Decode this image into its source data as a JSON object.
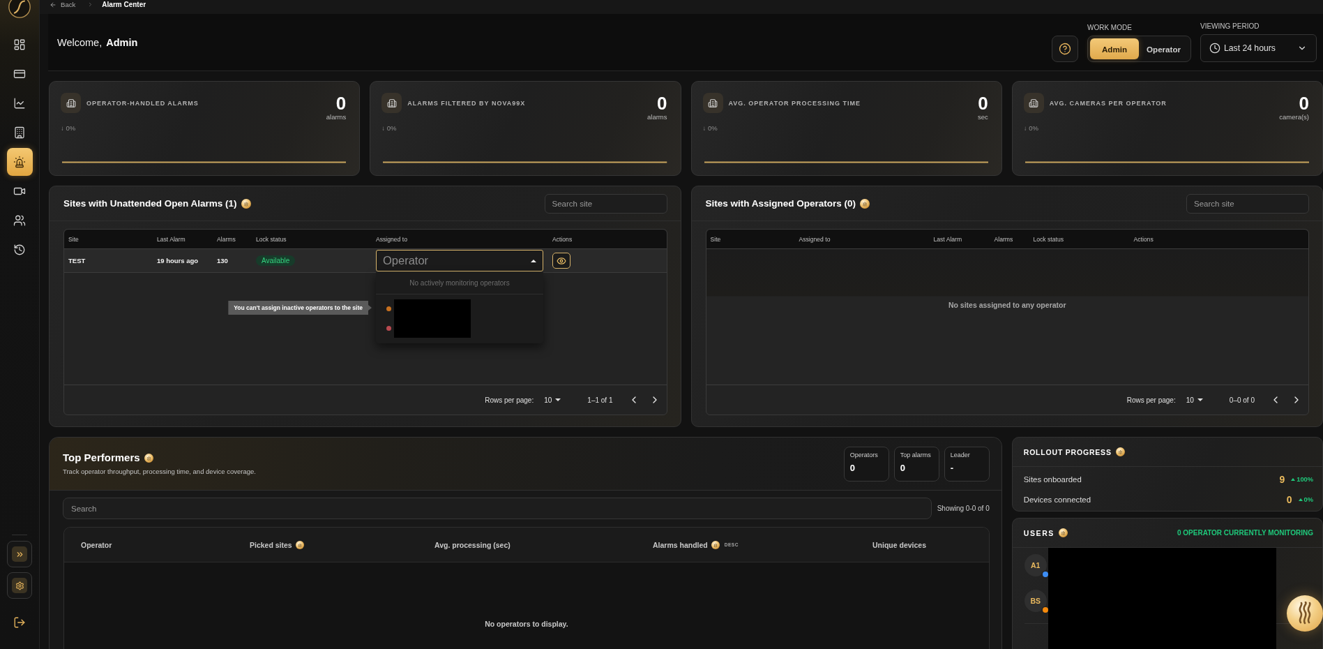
{
  "breadcrumb": {
    "back": "Back",
    "current": "Alarm Center"
  },
  "sidebar": {
    "items": [
      {
        "selected": false
      },
      {
        "selected": false
      },
      {
        "selected": false
      },
      {
        "selected": false
      },
      {
        "selected": true
      },
      {
        "selected": false
      },
      {
        "selected": false
      },
      {
        "selected": false
      }
    ]
  },
  "header": {
    "welcome": "Welcome, **Admin**",
    "work_mode": {
      "label": "WORK MODE",
      "options": [
        {
          "label": "Admin",
          "selected": true
        },
        {
          "label": "Operator",
          "selected": false
        }
      ]
    },
    "viewing_period": {
      "label": "VIEWING PERIOD",
      "value": "Last 24 hours"
    }
  },
  "stat_cards": [
    {
      "title": "OPERATOR-HANDLED ALARMS",
      "value": "0",
      "unit": "alarms",
      "change": "↓ 0%"
    },
    {
      "title": "ALARMS FILTERED BY NOVA99X",
      "value": "0",
      "unit": "alarms",
      "change": "↓ 0%"
    },
    {
      "title": "AVG. OPERATOR PROCESSING TIME",
      "value": "0",
      "unit": "sec",
      "change": "↓ 0%"
    },
    {
      "title": "AVG. CAMERAS PER OPERATOR",
      "value": "0",
      "unit": "camera(s)",
      "change": "↓ 0%"
    }
  ],
  "unattended_sites": {
    "title": "Sites with Unattended Open Alarms (1)",
    "search": {
      "placeholder": "Search site"
    },
    "columns": [
      "Site",
      "Last Alarm",
      "Alarms",
      "Lock status",
      "Assigned to",
      "Actions"
    ],
    "rows": [
      {
        "site": "TEST",
        "last_alarm": "19 hours ago",
        "alarms": "130",
        "lock_status": "Available",
        "assign": {
          "placeholder": "Operator",
          "expanded": true,
          "note": "No actively monitoring operators",
          "operators": [
            {
              "color": "#c7701f"
            },
            {
              "color": "#b94a50"
            }
          ],
          "tooltip": "You can't assign inactive operators to the site"
        }
      }
    ],
    "pagination": {
      "label": "Rows per page:",
      "rows": "10",
      "range": "1–1 of 1"
    }
  },
  "assigned_sites": {
    "title": "Sites with Assigned Operators (0)",
    "search": {
      "placeholder": "Search site"
    },
    "columns": [
      "Site",
      "Assigned to",
      "Last Alarm",
      "Alarms",
      "Lock status",
      "Actions"
    ],
    "empty": "No sites assigned to any operator",
    "pagination": {
      "label": "Rows per page:",
      "rows": "10",
      "range": "0–0 of 0"
    }
  },
  "top_performers": {
    "title": "Top Performers",
    "subtitle": "Track operator throughput, processing time, and device coverage.",
    "stats": [
      {
        "label": "Operators",
        "value": "0"
      },
      {
        "label": "Top alarms",
        "value": "0"
      },
      {
        "label": "Leader",
        "value": "-"
      }
    ],
    "search": {
      "placeholder": "Search"
    },
    "showing": "Showing 0-0 of 0",
    "columns": [
      {
        "label": "Operator",
        "kind": "plain"
      },
      {
        "label": "Picked sites",
        "kind": "info"
      },
      {
        "label": "Avg. processing (sec)",
        "kind": "plain"
      },
      {
        "label": "Alarms handled",
        "kind": "info",
        "sort": "DESC"
      },
      {
        "label": "Unique devices",
        "kind": "plain"
      }
    ],
    "empty": "No operators to display."
  },
  "rollout_progress": {
    "title": "ROLLOUT PROGRESS",
    "rows": [
      {
        "label": "Sites onboarded",
        "value": "9",
        "change": "100%"
      },
      {
        "label": "Devices connected",
        "value": "0",
        "change": "0%"
      }
    ]
  },
  "users": {
    "title": "USERS",
    "monitoring": "0 OPERATOR CURRENTLY MONITORING",
    "list": [
      {
        "initials": "A1",
        "color": "#3d8ef5"
      },
      {
        "initials": "BS",
        "color": "#f58a0c"
      }
    ]
  }
}
